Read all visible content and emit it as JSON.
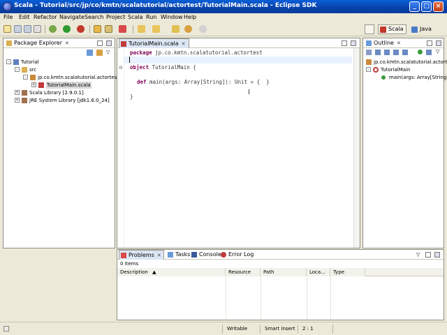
{
  "window": {
    "title": "Scala - Tutorial/src/jp/co/kmtn/scalatutorial/actortest/TutorialMain.scala - Eclipse SDK"
  },
  "menu": [
    "File",
    "Edit",
    "Refactor",
    "Navigate",
    "Search",
    "Project",
    "Scala",
    "Run",
    "Window",
    "Help"
  ],
  "perspectives": [
    {
      "label": "Scala",
      "active": true
    },
    {
      "label": "Java",
      "active": false
    }
  ],
  "package_explorer": {
    "tab_label": "Package Explorer",
    "tree": [
      {
        "label": "Tutorial"
      },
      {
        "label": "src"
      },
      {
        "label": "jp.co.kmtn.scalatutorial.actortest"
      },
      {
        "label": "TutorialMain.scala"
      },
      {
        "label": "Scala Library [2.9.0.1]"
      },
      {
        "label": "JRE System Library [jdk1.6.0_24]"
      }
    ]
  },
  "editor": {
    "tab_label": "TutorialMain.scala",
    "lines": {
      "l1_kw": "package",
      "l1_rest": " jp.co.kmtn.scalatutorial.actortest",
      "l3_kw": "object",
      "l3_rest": " TutorialMain {",
      "l5_kw": "def",
      "l5_rest": " main(args: Array[String]): Unit = {  }",
      "l7": "}"
    }
  },
  "outline": {
    "tab_label": "Outline",
    "tree": [
      {
        "label": "jp.co.kmtn.scalatutorial.actortest"
      },
      {
        "label": "TutorialMain"
      },
      {
        "label": "main(args: Array[String])"
      }
    ]
  },
  "bottom": {
    "tabs": [
      "Problems",
      "Tasks",
      "Console",
      "Error Log"
    ],
    "items_count": "0 items",
    "columns": [
      "Description",
      "Resource",
      "Path",
      "Loca...",
      "Type"
    ]
  },
  "status": {
    "writable": "Writable",
    "insert_mode": "Smart Insert",
    "position": "2 : 1"
  },
  "colors": {
    "title_bar": "#0a4bc0",
    "keyword": "#7f0055"
  }
}
